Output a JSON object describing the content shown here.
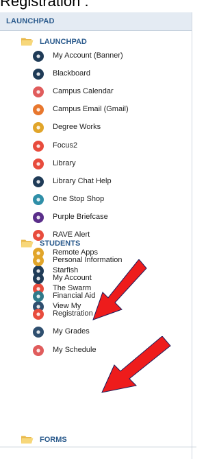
{
  "caption": "Registration :",
  "panel": {
    "header": "LAUNCHPAD",
    "folders": [
      {
        "label": "LAUNCHPAD",
        "items": [
          {
            "label": "My Account (Banner)",
            "icon": "key-icon",
            "color": "#1f3b57"
          },
          {
            "label": "Blackboard",
            "icon": "blackboard-icon",
            "color": "#1f3b57"
          },
          {
            "label": "Campus Calendar",
            "icon": "calendar-icon",
            "color": "#e05c5c"
          },
          {
            "label": "Campus Email (Gmail)",
            "icon": "mail-icon",
            "color": "#e8772e"
          },
          {
            "label": "Degree Works",
            "icon": "graduation-cap-icon",
            "color": "#e1a52a"
          },
          {
            "label": "Focus2",
            "icon": "focus-icon",
            "color": "#e84c3d"
          },
          {
            "label": "Library",
            "icon": "book-icon",
            "color": "#e84c3d"
          },
          {
            "label": "Library Chat Help",
            "icon": "chat-icon",
            "color": "#1f3b57"
          },
          {
            "label": "One Stop Shop",
            "icon": "cart-icon",
            "color": "#2f8fa8"
          },
          {
            "label": "Purple Briefcase",
            "icon": "briefcase-icon",
            "color": "#5a2e8a"
          },
          {
            "label": "RAVE Alert",
            "icon": "alert-icon",
            "color": "#e84c3d"
          },
          {
            "label": "Remote Apps",
            "icon": "apps-icon",
            "color": "#e1a52a"
          },
          {
            "label": "Starfish",
            "icon": "starfish-icon",
            "color": "#1f3b57"
          },
          {
            "label": "The Swarm",
            "icon": "swarm-icon",
            "color": "#e84c3d"
          },
          {
            "label": "View My",
            "icon": "document-icon",
            "color": "#2f4f6f"
          }
        ]
      },
      {
        "label": "STUDENTS",
        "items": [
          {
            "label": "Personal Information",
            "icon": "person-icon",
            "color": "#e1a52a"
          },
          {
            "label": "My Account",
            "icon": "account-icon",
            "color": "#1f3b57"
          },
          {
            "label": "Financial Aid",
            "icon": "financial-aid-icon",
            "color": "#2f7a8a"
          },
          {
            "label": "Registration",
            "icon": "star-icon",
            "color": "#e84c3d"
          },
          {
            "label": "My Grades",
            "icon": "award-icon",
            "color": "#2f4f6f"
          },
          {
            "label": "My Schedule",
            "icon": "schedule-icon",
            "color": "#e05c5c"
          }
        ]
      },
      {
        "label": "FORMS",
        "items": []
      }
    ]
  },
  "colors": {
    "folder_label": "#2a5a8c",
    "header_bg": "#e4ebf3",
    "arrow": "#ee1c1c"
  }
}
